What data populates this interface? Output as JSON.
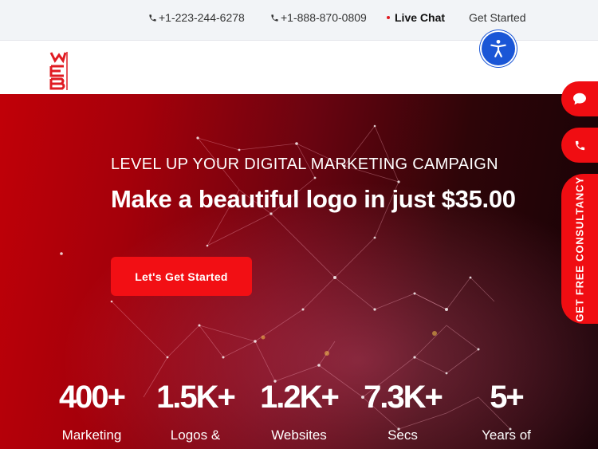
{
  "topbar": {
    "phone1": "+1-223-244-6278",
    "phone2": "+1-888-870-0809",
    "live_chat": "Live Chat",
    "get_started": "Get Started"
  },
  "hero": {
    "eyebrow": "LEVEL UP YOUR DIGITAL MARKETING CAMPAIGN",
    "headline": "Make a beautiful logo in just $35.00",
    "cta_label": "Let's Get Started"
  },
  "stats": [
    {
      "value": "400+",
      "label": "Marketing"
    },
    {
      "value": "1.5K+",
      "label": "Logos &"
    },
    {
      "value": "1.2K+",
      "label": "Websites"
    },
    {
      "value": "7.3K+",
      "label": "Secs"
    },
    {
      "value": "5+",
      "label": "Years of"
    }
  ],
  "side": {
    "consult_label": "GET FREE CONSULTANCY"
  },
  "icons": {
    "phone": "phone-icon",
    "chat": "chat-icon",
    "accessibility": "accessibility-icon"
  },
  "colors": {
    "accent_red": "#f20f14",
    "accessibility_blue": "#1a56d6"
  }
}
